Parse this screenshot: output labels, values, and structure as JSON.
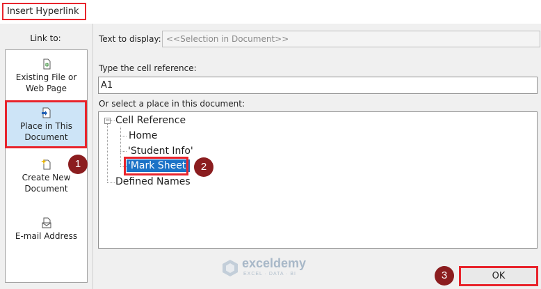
{
  "dialog": {
    "title": "Insert Hyperlink",
    "link_to_label": "Link to:",
    "link_to_items": [
      {
        "line1": "Existing File or",
        "line2": "Web Page",
        "icon": "file-icon",
        "selected": false
      },
      {
        "line1": "Place in This",
        "line2": "Document",
        "icon": "place-in-document-icon",
        "selected": true
      },
      {
        "line1": "Create New",
        "line2": "Document",
        "icon": "new-document-icon",
        "selected": false
      },
      {
        "line1": "E-mail Address",
        "line2": "",
        "icon": "email-icon",
        "selected": false
      }
    ],
    "text_to_display_label": "Text to display:",
    "text_to_display_value": "<<Selection in Document>>",
    "cell_reference_label": "Type the cell reference:",
    "cell_reference_value": "A1",
    "place_label": "Or select a place in this document:",
    "tree": {
      "expander": "−",
      "cell_reference_node": "Cell Reference",
      "sheets": [
        "Home",
        "'Student Info'",
        "'Mark Sheet'"
      ],
      "selected_sheet": "'Mark Sheet'",
      "defined_names_node": "Defined Names"
    },
    "ok_label": "OK",
    "badges": [
      "1",
      "2",
      "3"
    ],
    "accent_color": "#e8242c",
    "selection_color": "#1a72c7",
    "badge_color": "#8b1d1f"
  },
  "watermark": {
    "name": "exceldemy",
    "tagline": "EXCEL · DATA · BI"
  }
}
